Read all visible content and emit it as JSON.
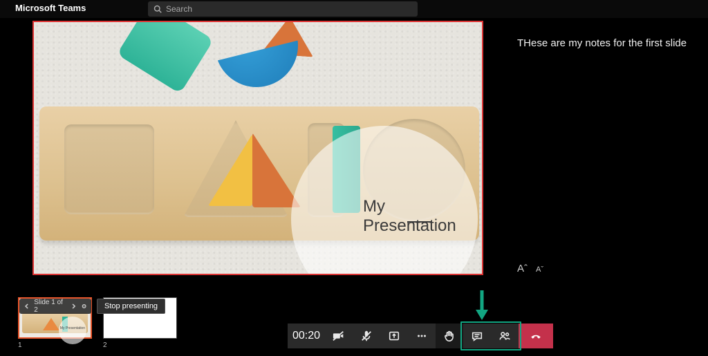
{
  "app": {
    "title": "Microsoft Teams"
  },
  "search": {
    "placeholder": "Search"
  },
  "slide": {
    "title": "My Presentation",
    "notes": "THese are my notes for the first slide"
  },
  "filmstrip": {
    "counter": "Slide 1 of 2",
    "thumbs": [
      {
        "num": "1",
        "label": "My Presentation"
      },
      {
        "num": "2",
        "label": ""
      }
    ],
    "stop_label": "Stop presenting"
  },
  "call": {
    "duration": "00:20"
  },
  "font_controls": {
    "increase": "Aˆ",
    "decrease": "Aˇ"
  },
  "colors": {
    "accent_teal": "#12a682",
    "hangup_red": "#c4314b",
    "slide_border": "#d33",
    "thumb_active": "#e8552b"
  }
}
